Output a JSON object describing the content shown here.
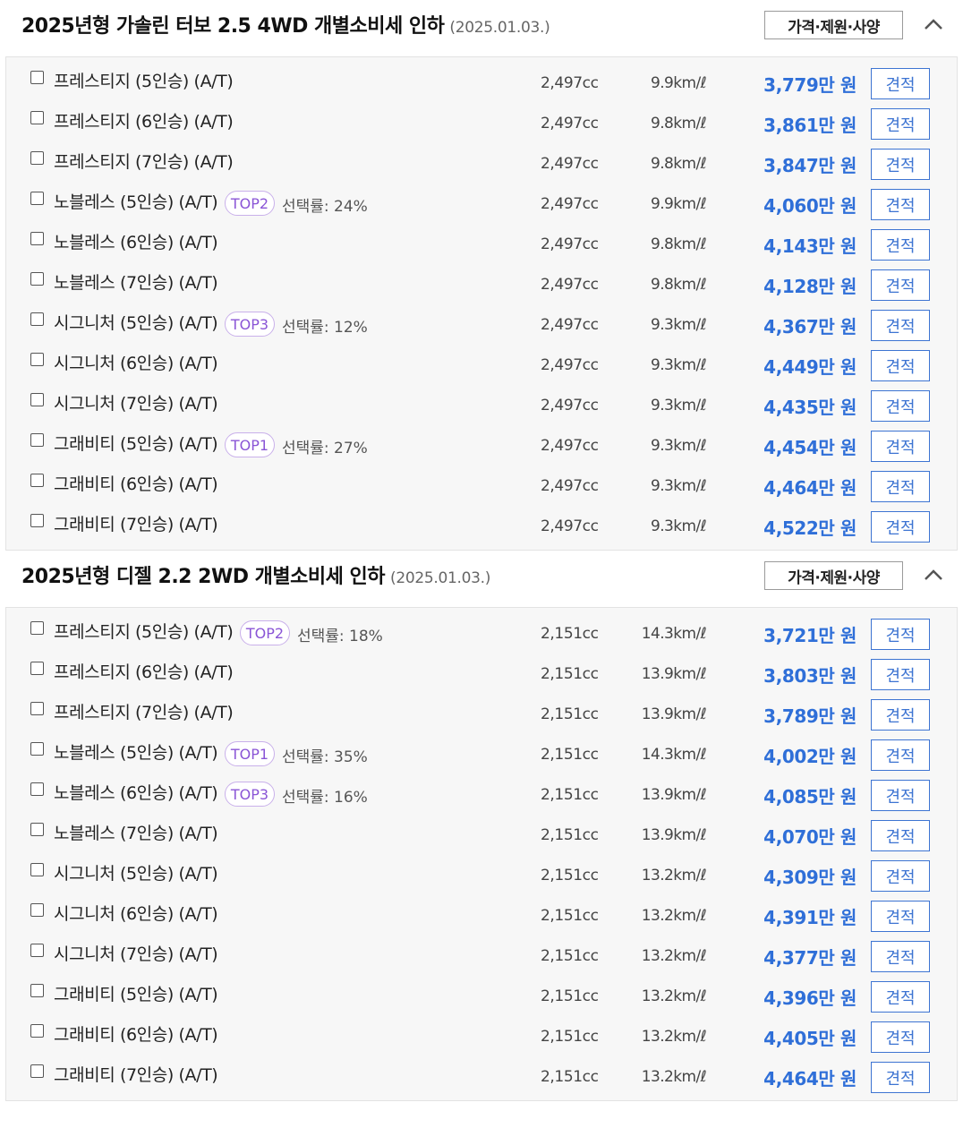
{
  "sections": [
    {
      "title": "2025년형 가솔린 터보 2.5 4WD 개별소비세 인하",
      "date": "(2025.01.03.)",
      "spec_label": "가격·제원·사양",
      "rows": [
        {
          "name": "프레스티지 (5인승) (A/T)",
          "badge": "",
          "rate": "",
          "cc": "2,497cc",
          "eff": "9.9km/ℓ",
          "price": "3,779만 원",
          "quote": "견적"
        },
        {
          "name": "프레스티지 (6인승) (A/T)",
          "badge": "",
          "rate": "",
          "cc": "2,497cc",
          "eff": "9.8km/ℓ",
          "price": "3,861만 원",
          "quote": "견적"
        },
        {
          "name": "프레스티지 (7인승) (A/T)",
          "badge": "",
          "rate": "",
          "cc": "2,497cc",
          "eff": "9.8km/ℓ",
          "price": "3,847만 원",
          "quote": "견적"
        },
        {
          "name": "노블레스 (5인승) (A/T)",
          "badge": "TOP2",
          "rate": "선택률: 24%",
          "cc": "2,497cc",
          "eff": "9.9km/ℓ",
          "price": "4,060만 원",
          "quote": "견적"
        },
        {
          "name": "노블레스 (6인승) (A/T)",
          "badge": "",
          "rate": "",
          "cc": "2,497cc",
          "eff": "9.8km/ℓ",
          "price": "4,143만 원",
          "quote": "견적"
        },
        {
          "name": "노블레스 (7인승) (A/T)",
          "badge": "",
          "rate": "",
          "cc": "2,497cc",
          "eff": "9.8km/ℓ",
          "price": "4,128만 원",
          "quote": "견적"
        },
        {
          "name": "시그니처 (5인승) (A/T)",
          "badge": "TOP3",
          "rate": "선택률: 12%",
          "cc": "2,497cc",
          "eff": "9.3km/ℓ",
          "price": "4,367만 원",
          "quote": "견적"
        },
        {
          "name": "시그니처 (6인승) (A/T)",
          "badge": "",
          "rate": "",
          "cc": "2,497cc",
          "eff": "9.3km/ℓ",
          "price": "4,449만 원",
          "quote": "견적"
        },
        {
          "name": "시그니처 (7인승) (A/T)",
          "badge": "",
          "rate": "",
          "cc": "2,497cc",
          "eff": "9.3km/ℓ",
          "price": "4,435만 원",
          "quote": "견적"
        },
        {
          "name": "그래비티 (5인승) (A/T)",
          "badge": "TOP1",
          "rate": "선택률: 27%",
          "cc": "2,497cc",
          "eff": "9.3km/ℓ",
          "price": "4,454만 원",
          "quote": "견적"
        },
        {
          "name": "그래비티 (6인승) (A/T)",
          "badge": "",
          "rate": "",
          "cc": "2,497cc",
          "eff": "9.3km/ℓ",
          "price": "4,464만 원",
          "quote": "견적"
        },
        {
          "name": "그래비티 (7인승) (A/T)",
          "badge": "",
          "rate": "",
          "cc": "2,497cc",
          "eff": "9.3km/ℓ",
          "price": "4,522만 원",
          "quote": "견적"
        }
      ]
    },
    {
      "title": "2025년형 디젤 2.2 2WD 개별소비세 인하",
      "date": "(2025.01.03.)",
      "spec_label": "가격·제원·사양",
      "rows": [
        {
          "name": "프레스티지 (5인승) (A/T)",
          "badge": "TOP2",
          "rate": "선택률: 18%",
          "cc": "2,151cc",
          "eff": "14.3km/ℓ",
          "price": "3,721만 원",
          "quote": "견적"
        },
        {
          "name": "프레스티지 (6인승) (A/T)",
          "badge": "",
          "rate": "",
          "cc": "2,151cc",
          "eff": "13.9km/ℓ",
          "price": "3,803만 원",
          "quote": "견적"
        },
        {
          "name": "프레스티지 (7인승) (A/T)",
          "badge": "",
          "rate": "",
          "cc": "2,151cc",
          "eff": "13.9km/ℓ",
          "price": "3,789만 원",
          "quote": "견적"
        },
        {
          "name": "노블레스 (5인승) (A/T)",
          "badge": "TOP1",
          "rate": "선택률: 35%",
          "cc": "2,151cc",
          "eff": "14.3km/ℓ",
          "price": "4,002만 원",
          "quote": "견적"
        },
        {
          "name": "노블레스 (6인승) (A/T)",
          "badge": "TOP3",
          "rate": "선택률: 16%",
          "cc": "2,151cc",
          "eff": "13.9km/ℓ",
          "price": "4,085만 원",
          "quote": "견적"
        },
        {
          "name": "노블레스 (7인승) (A/T)",
          "badge": "",
          "rate": "",
          "cc": "2,151cc",
          "eff": "13.9km/ℓ",
          "price": "4,070만 원",
          "quote": "견적"
        },
        {
          "name": "시그니처 (5인승) (A/T)",
          "badge": "",
          "rate": "",
          "cc": "2,151cc",
          "eff": "13.2km/ℓ",
          "price": "4,309만 원",
          "quote": "견적"
        },
        {
          "name": "시그니처 (6인승) (A/T)",
          "badge": "",
          "rate": "",
          "cc": "2,151cc",
          "eff": "13.2km/ℓ",
          "price": "4,391만 원",
          "quote": "견적"
        },
        {
          "name": "시그니처 (7인승) (A/T)",
          "badge": "",
          "rate": "",
          "cc": "2,151cc",
          "eff": "13.2km/ℓ",
          "price": "4,377만 원",
          "quote": "견적"
        },
        {
          "name": "그래비티 (5인승) (A/T)",
          "badge": "",
          "rate": "",
          "cc": "2,151cc",
          "eff": "13.2km/ℓ",
          "price": "4,396만 원",
          "quote": "견적"
        },
        {
          "name": "그래비티 (6인승) (A/T)",
          "badge": "",
          "rate": "",
          "cc": "2,151cc",
          "eff": "13.2km/ℓ",
          "price": "4,405만 원",
          "quote": "견적"
        },
        {
          "name": "그래비티 (7인승) (A/T)",
          "badge": "",
          "rate": "",
          "cc": "2,151cc",
          "eff": "13.2km/ℓ",
          "price": "4,464만 원",
          "quote": "견적"
        }
      ]
    }
  ]
}
